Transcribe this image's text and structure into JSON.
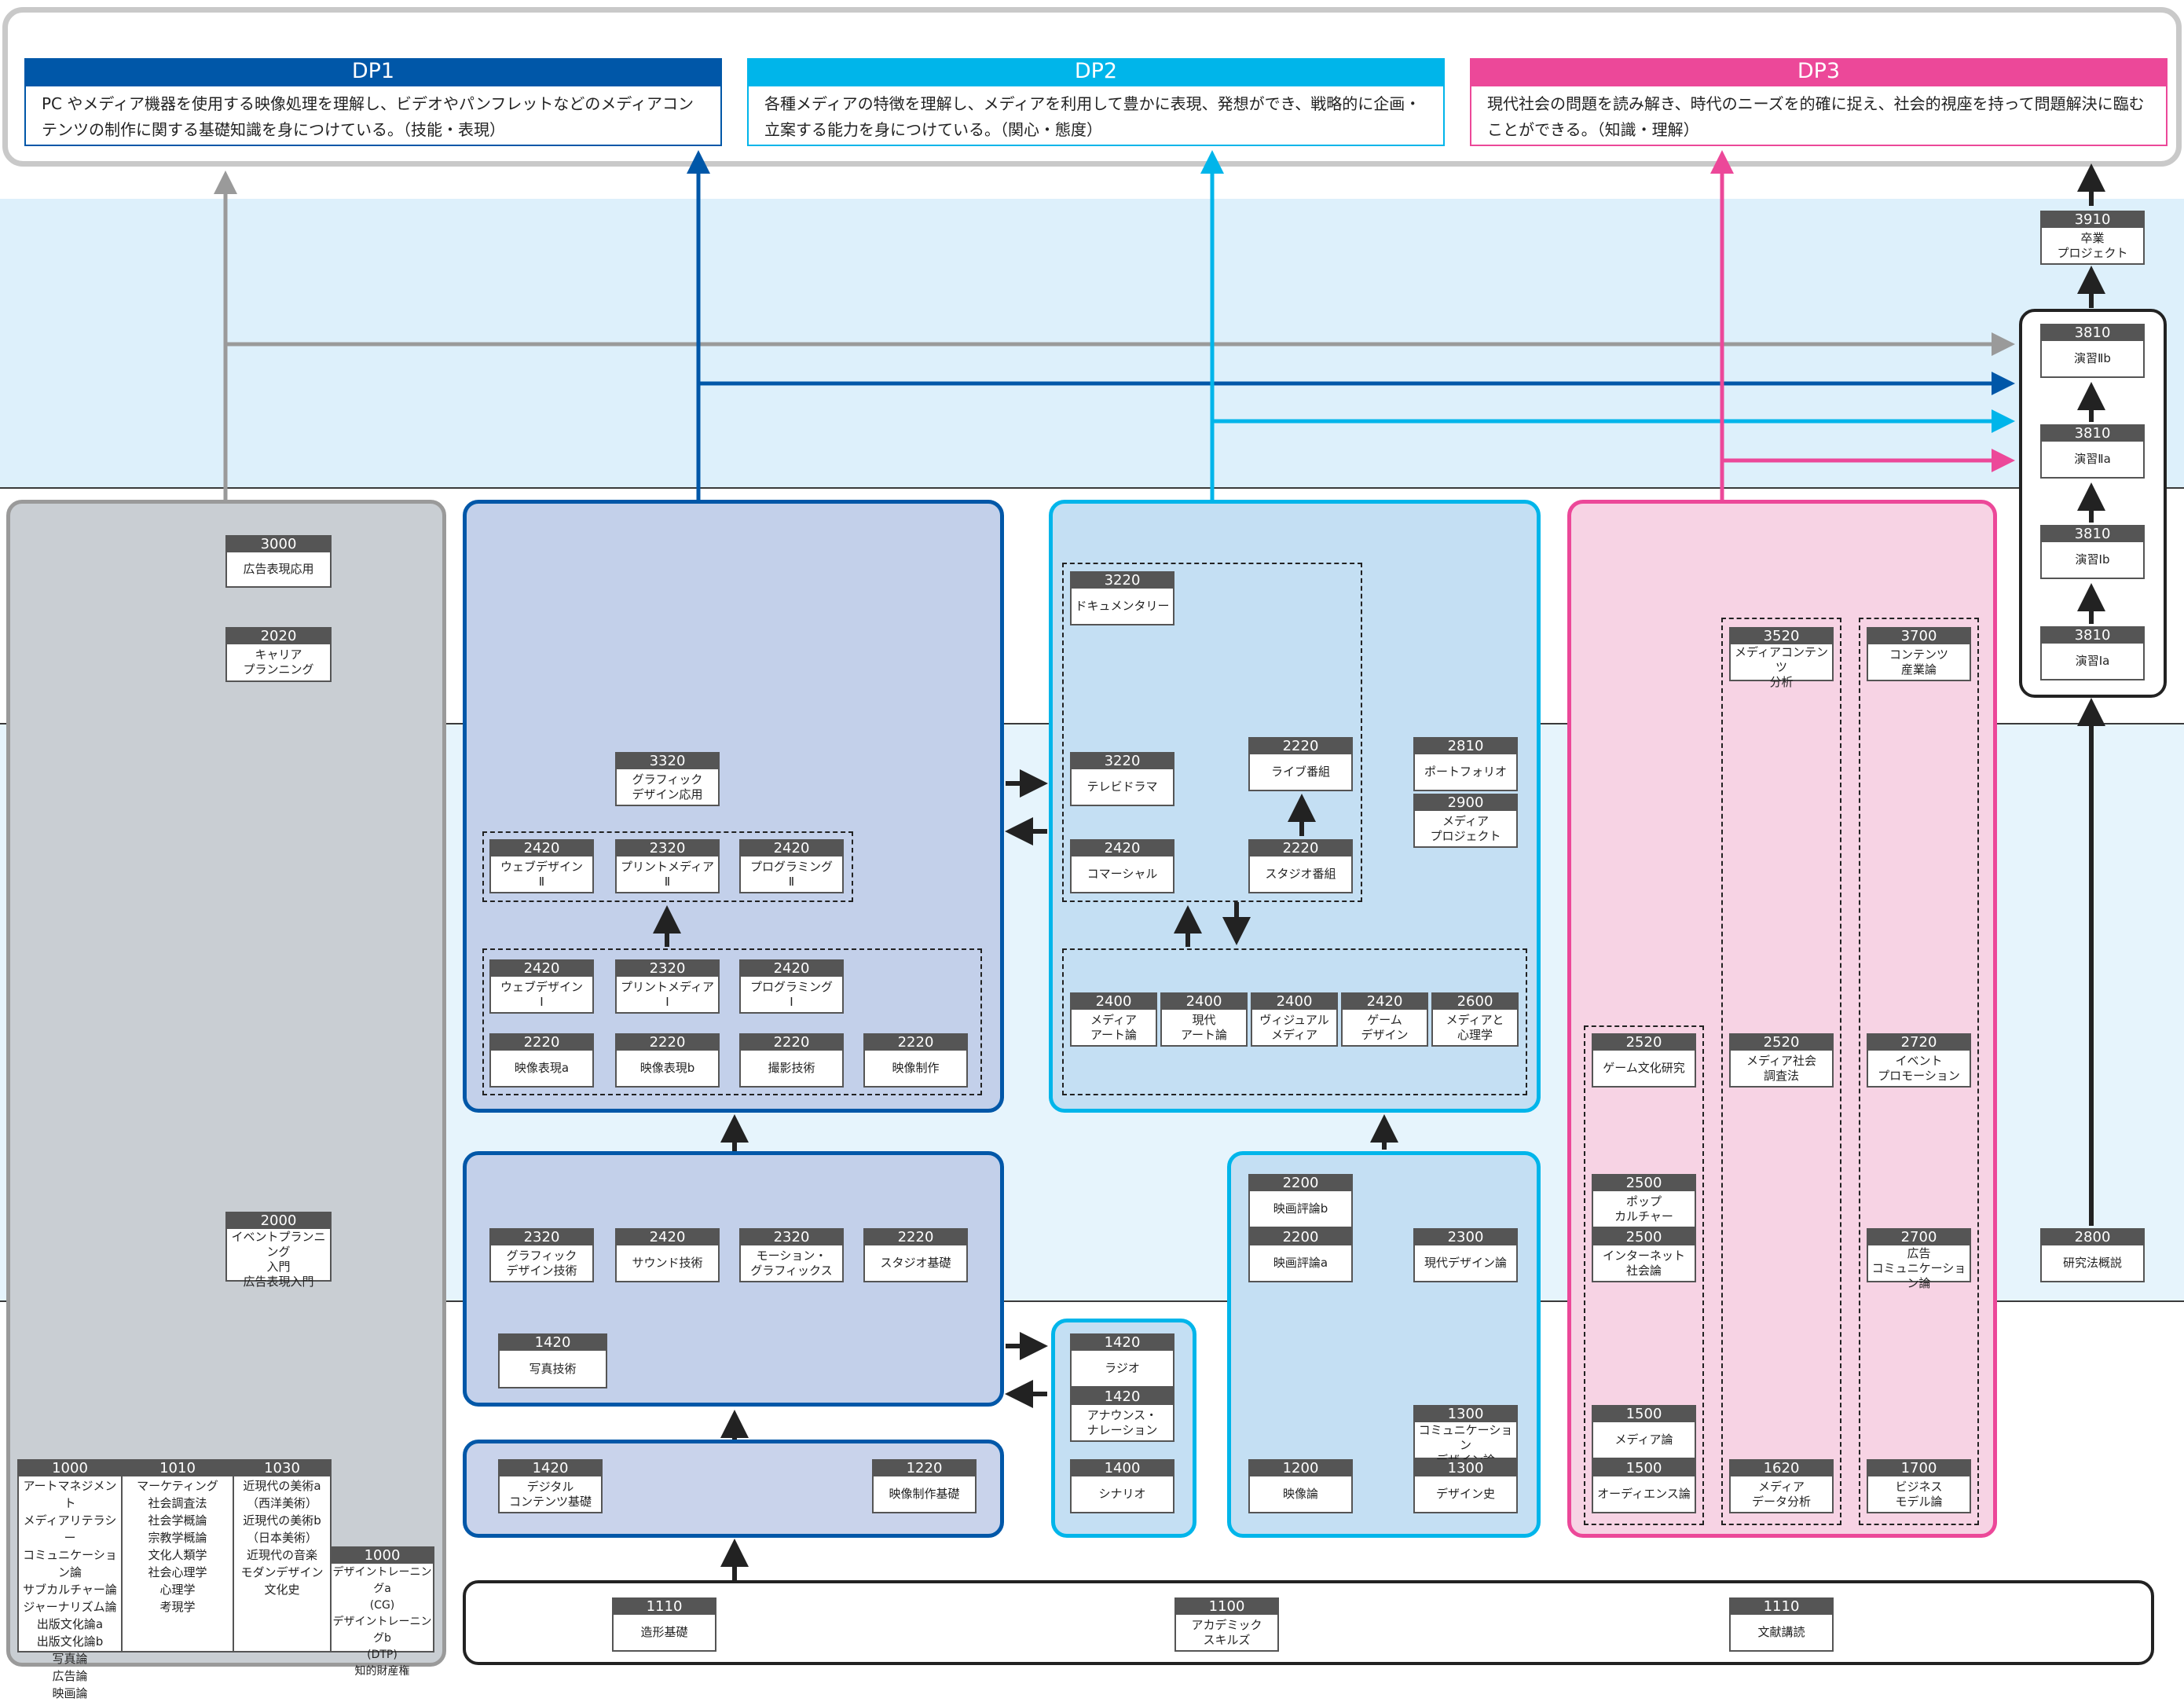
{
  "colors": {
    "dp1": "#0057a8",
    "dp2": "#00b5ea",
    "dp3": "#ec4899",
    "gray": "#9a9a9a",
    "dark": "#222222",
    "band_light": "#ddf0fb",
    "gray_area": "#c9ced3",
    "blue_area": "#c3d0ea",
    "cyan_area": "#c4dff3",
    "pink_area": "#f7d3e4"
  },
  "dp": [
    {
      "title": "DP1",
      "text": "PC やメディア機器を使用する映像処理を理解し、ビデオやパンフレットなどのメディアコンテンツの制作に関する基礎知識を身につけている。（技能・表現）"
    },
    {
      "title": "DP2",
      "text": "各種メディアの特徴を理解し、メディアを利用して豊かに表現、発想ができ、戦略的に企画・立案する能力を身につけている。（関心・態度）"
    },
    {
      "title": "DP3",
      "text": "現代社会の問題を読み解き、時代のニーズを的確に捉え、社会的視座を持って問題解決に臨むことができる。（知識・理解）"
    }
  ],
  "courses": {
    "gray_3000": {
      "code": "3000",
      "name": "広告表現応用"
    },
    "gray_2020": {
      "code": "2020",
      "name": "キャリア\nプランニング"
    },
    "gray_2000": {
      "code": "2000",
      "name": "イベントプランニング\n入門\n広告表現入門"
    },
    "b_3320": {
      "code": "3320",
      "name": "グラフィック\nデザイン応用"
    },
    "b_2420_web2": {
      "code": "2420",
      "name": "ウェブデザイン\nⅡ"
    },
    "b_2320_print2": {
      "code": "2320",
      "name": "プリントメディア\nⅡ"
    },
    "b_2420_prog2": {
      "code": "2420",
      "name": "プログラミング\nⅡ"
    },
    "b_2420_web1": {
      "code": "2420",
      "name": "ウェブデザイン\nⅠ"
    },
    "b_2320_print1": {
      "code": "2320",
      "name": "プリントメディア\nⅠ"
    },
    "b_2420_prog1": {
      "code": "2420",
      "name": "プログラミング\nⅠ"
    },
    "b_2220_eizoa": {
      "code": "2220",
      "name": "映像表現a"
    },
    "b_2220_eizob": {
      "code": "2220",
      "name": "映像表現b"
    },
    "b_2220_satsuei": {
      "code": "2220",
      "name": "撮影技術"
    },
    "b_2220_seisaku": {
      "code": "2220",
      "name": "映像制作"
    },
    "b_2320_graphic": {
      "code": "2320",
      "name": "グラフィック\nデザイン技術"
    },
    "b_2420_sound": {
      "code": "2420",
      "name": "サウンド技術"
    },
    "b_2320_motion": {
      "code": "2320",
      "name": "モーション・\nグラフィックス"
    },
    "b_2220_studio": {
      "code": "2220",
      "name": "スタジオ基礎"
    },
    "b_1420_photo": {
      "code": "1420",
      "name": "写真技術"
    },
    "b_1420_digital": {
      "code": "1420",
      "name": "デジタル\nコンテンツ基礎"
    },
    "b_1220_eizokiso": {
      "code": "1220",
      "name": "映像制作基礎"
    },
    "c_3220_doc": {
      "code": "3220",
      "name": "ドキュメンタリー"
    },
    "c_3220_drama": {
      "code": "3220",
      "name": "テレビドラマ"
    },
    "c_2220_live": {
      "code": "2220",
      "name": "ライブ番組"
    },
    "c_2420_cm": {
      "code": "2420",
      "name": "コマーシャル"
    },
    "c_2220_studio": {
      "code": "2220",
      "name": "スタジオ番組"
    },
    "c_2810_portfolio": {
      "code": "2810",
      "name": "ポートフォリオ"
    },
    "c_2900_mediaproj": {
      "code": "2900",
      "name": "メディア\nプロジェクト"
    },
    "c_2400_mediaart": {
      "code": "2400",
      "name": "メディア\nアート論"
    },
    "c_2400_gendai": {
      "code": "2400",
      "name": "現代\nアート論"
    },
    "c_2400_visual": {
      "code": "2400",
      "name": "ヴィジュアル\nメディア"
    },
    "c_2420_game": {
      "code": "2420",
      "name": "ゲーム\nデザイン"
    },
    "c_2600_shinri": {
      "code": "2600",
      "name": "メディアと\n心理学"
    },
    "c_2200_eigab": {
      "code": "2200",
      "name": "映画評論b"
    },
    "c_2200_eigaa": {
      "code": "2200",
      "name": "映画評論a"
    },
    "c_2300_gendaidesign": {
      "code": "2300",
      "name": "現代デザイン論"
    },
    "c_1420_radio": {
      "code": "1420",
      "name": "ラジオ"
    },
    "c_1420_announce": {
      "code": "1420",
      "name": "アナウンス・\nナレーション"
    },
    "c_1400_scenario": {
      "code": "1400",
      "name": "シナリオ"
    },
    "c_1300_comm": {
      "code": "1300",
      "name": "コミュニケーション\nデザイン論"
    },
    "c_1200_eizoron": {
      "code": "1200",
      "name": "映像論"
    },
    "c_1300_designshi": {
      "code": "1300",
      "name": "デザイン史"
    },
    "p_3520_analysis": {
      "code": "3520",
      "name": "メディアコンテンツ\n分析"
    },
    "p_3700_industry": {
      "code": "3700",
      "name": "コンテンツ\n産業論"
    },
    "p_2520_gamebunka": {
      "code": "2520",
      "name": "ゲーム文化研究"
    },
    "p_2520_survey": {
      "code": "2520",
      "name": "メディア社会\n調査法"
    },
    "p_2720_event": {
      "code": "2720",
      "name": "イベント\nプロモーション"
    },
    "p_2500_pop": {
      "code": "2500",
      "name": "ポップ\nカルチャー"
    },
    "p_2500_internet": {
      "code": "2500",
      "name": "インターネット\n社会論"
    },
    "p_2700_adcomm": {
      "code": "2700",
      "name": "広告\nコミュニケーション論"
    },
    "p_1500_media": {
      "code": "1500",
      "name": "メディア論"
    },
    "p_1500_audience": {
      "code": "1500",
      "name": "オーディエンス論"
    },
    "p_1620_data": {
      "code": "1620",
      "name": "メディア\nデータ分析"
    },
    "p_1700_business": {
      "code": "1700",
      "name": "ビジネス\nモデル論"
    },
    "r_3910": {
      "code": "3910",
      "name": "卒業\nプロジェクト"
    },
    "r_3810_2b": {
      "code": "3810",
      "name": "演習Ⅱb"
    },
    "r_3810_2a": {
      "code": "3810",
      "name": "演習Ⅱa"
    },
    "r_3810_1b": {
      "code": "3810",
      "name": "演習Ⅰb"
    },
    "r_3810_1a": {
      "code": "3810",
      "name": "演習Ⅰa"
    },
    "r_2800": {
      "code": "2800",
      "name": "研究法概説"
    },
    "f_1110_zokei": {
      "code": "1110",
      "name": "造形基礎"
    },
    "f_1100_academic": {
      "code": "1100",
      "name": "アカデミック\nスキルズ"
    },
    "f_1110_bunken": {
      "code": "1110",
      "name": "文献講読"
    }
  },
  "categories": [
    {
      "code": "1000",
      "list": "アートマネジメント\nメディアリテラシー\nコミュニケーション論\nサブカルチャー論\nジャーナリズム論\n出版文化論a\n出版文化論b\n写真論\n広告論\n映画論"
    },
    {
      "code": "1010",
      "list": "マーケティング\n社会調査法\n社会学概論\n宗教学概論\n文化人類学\n社会心理学\n心理学\n考現学"
    },
    {
      "code": "1030",
      "list": "近現代の美術a\n（西洋美術）\n近現代の美術b\n（日本美術）\n近現代の音楽\nモダンデザイン\n文化史"
    },
    {
      "code": "1000",
      "list": "デザイントレーニングa\n(CG)\nデザイントレーニングb\n(DTP)\n知的財産権"
    }
  ]
}
